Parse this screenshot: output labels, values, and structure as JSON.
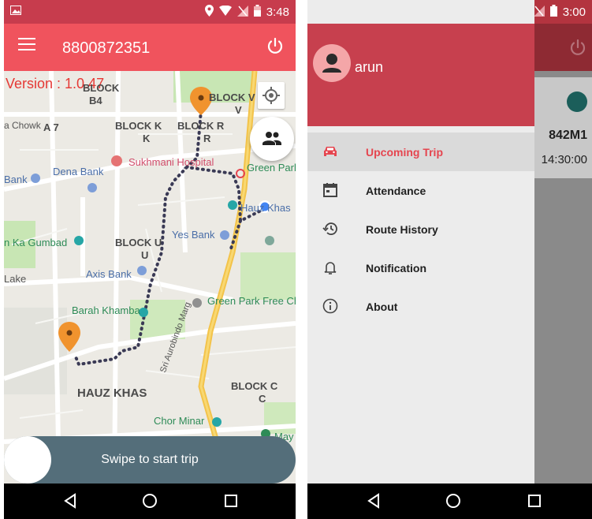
{
  "left_screen": {
    "status_bar": {
      "time": "3:48"
    },
    "app_bar": {
      "title": "8800872351"
    },
    "map": {
      "version_text": "Version : 1.0.47",
      "labels": [
        {
          "text": "BLOCK",
          "kind": "bold"
        },
        {
          "text": "B4",
          "kind": "bold"
        },
        {
          "text": "BLOCK V",
          "kind": "bold"
        },
        {
          "text": "V",
          "kind": "bold"
        },
        {
          "text": "a Chowk",
          "kind": "plain"
        },
        {
          "text": "A 7",
          "kind": "bold"
        },
        {
          "text": "BLOCK K",
          "kind": "bold"
        },
        {
          "text": "K",
          "kind": "bold"
        },
        {
          "text": "BLOCK R",
          "kind": "bold"
        },
        {
          "text": "R",
          "kind": "bold"
        },
        {
          "text": "Sukhmani Hospital",
          "kind": "pink"
        },
        {
          "text": "Dena Bank",
          "kind": "blue"
        },
        {
          "text": "Bank",
          "kind": "blue"
        },
        {
          "text": "Green Park",
          "kind": "green"
        },
        {
          "text": "Hauz Khas",
          "kind": "blue"
        },
        {
          "text": "Yes Bank",
          "kind": "blue"
        },
        {
          "text": "n Ka Gumbad",
          "kind": "green"
        },
        {
          "text": "BLOCK U",
          "kind": "bold"
        },
        {
          "text": "U",
          "kind": "bold"
        },
        {
          "text": "Axis Bank",
          "kind": "blue"
        },
        {
          "text": "Lake",
          "kind": "plain"
        },
        {
          "text": "Barah Khamba",
          "kind": "green"
        },
        {
          "text": "Green Park Free Ch",
          "kind": "green"
        },
        {
          "text": "Sri Aurobindo Marg",
          "kind": "plain"
        },
        {
          "text": "HAUZ KHAS",
          "kind": "bold"
        },
        {
          "text": "BLOCK C",
          "kind": "bold"
        },
        {
          "text": "C",
          "kind": "bold"
        },
        {
          "text": "Chor Minar",
          "kind": "green"
        },
        {
          "text": "May",
          "kind": "green"
        }
      ]
    },
    "swipe_button": {
      "label": "Swipe to start trip"
    }
  },
  "right_screen": {
    "status_bar": {
      "time": "3:00"
    },
    "drawer": {
      "username": "arun",
      "items": [
        {
          "label": "Upcoming Trip",
          "icon": "car-icon",
          "active": true
        },
        {
          "label": "Attendance",
          "icon": "calendar-icon",
          "active": false
        },
        {
          "label": "Route History",
          "icon": "history-icon",
          "active": false
        },
        {
          "label": "Notification",
          "icon": "bell-icon",
          "active": false
        },
        {
          "label": "About",
          "icon": "info-icon",
          "active": false
        }
      ]
    },
    "background_card": {
      "number": "842M1",
      "time": "14:30:00"
    }
  },
  "colors": {
    "accent": "#f0535d",
    "status": "#c73c4d",
    "drawer_head": "#c7404e",
    "swipe": "#546e7a",
    "route_dot": "#3a3a55"
  }
}
